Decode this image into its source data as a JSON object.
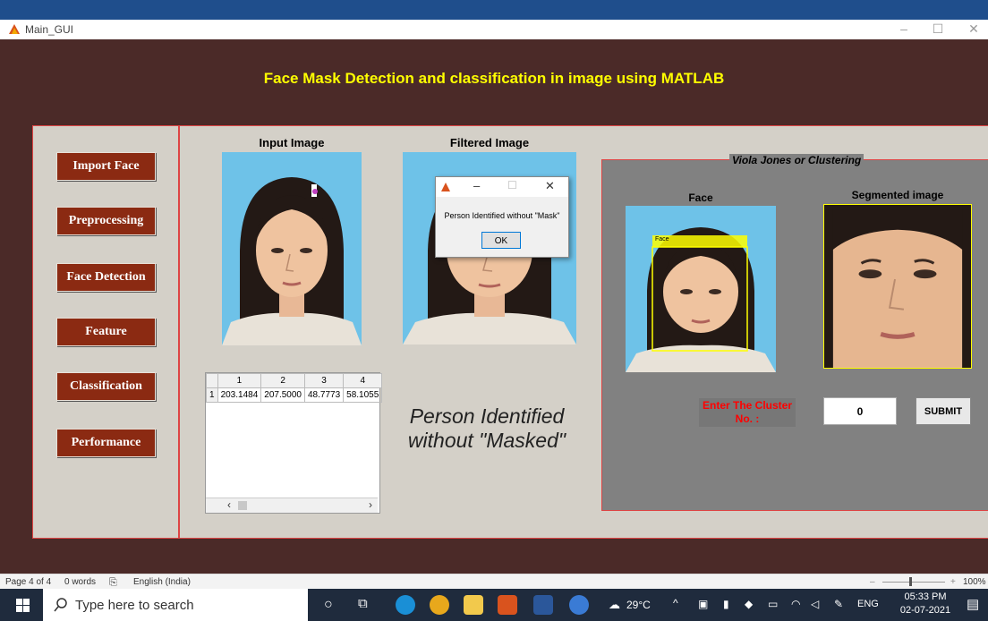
{
  "window": {
    "title": "Main_GUI"
  },
  "heading": "Face Mask Detection and classification in image using MATLAB",
  "nav_buttons": [
    "Import Face",
    "Preprocessing",
    "Face Detection",
    "Feature",
    "Classification",
    "Performance"
  ],
  "input_image_title": "Input Image",
  "filtered_image_title": "Filtered Image",
  "table": {
    "col_headers": [
      "1",
      "2",
      "3",
      "4"
    ],
    "row_header": "1",
    "values": [
      "203.1484",
      "207.5000",
      "48.7773",
      "58.1055"
    ]
  },
  "result_text_line1": "Person Identified",
  "result_text_line2": "without \"Masked\"",
  "viola_panel_title": "Viola Jones or  Clustering",
  "face_title": "Face",
  "segmented_title": "Segmented image",
  "face_box_label": "Face",
  "cluster_label": "Enter The Cluster No. :",
  "cluster_input_value": "0",
  "submit_label": "SUBMIT",
  "dialog": {
    "message": "Person Identified without \"Mask\"",
    "ok_label": "OK"
  },
  "statusbar": {
    "page": "Page 4 of 4",
    "words": "0 words",
    "language": "English (India)",
    "zoom": "100%"
  },
  "taskbar": {
    "search_placeholder": "Type here to search",
    "temperature": "29°C",
    "lang": "ENG",
    "time": "05:33 PM",
    "date": "02-07-2021"
  },
  "colors": {
    "background": "#4b2a28",
    "panel": "#d4d0c8",
    "button": "#8b2a12",
    "heading": "#ffff00",
    "cluster_text": "#ff0000",
    "viola_panel": "#818181"
  }
}
